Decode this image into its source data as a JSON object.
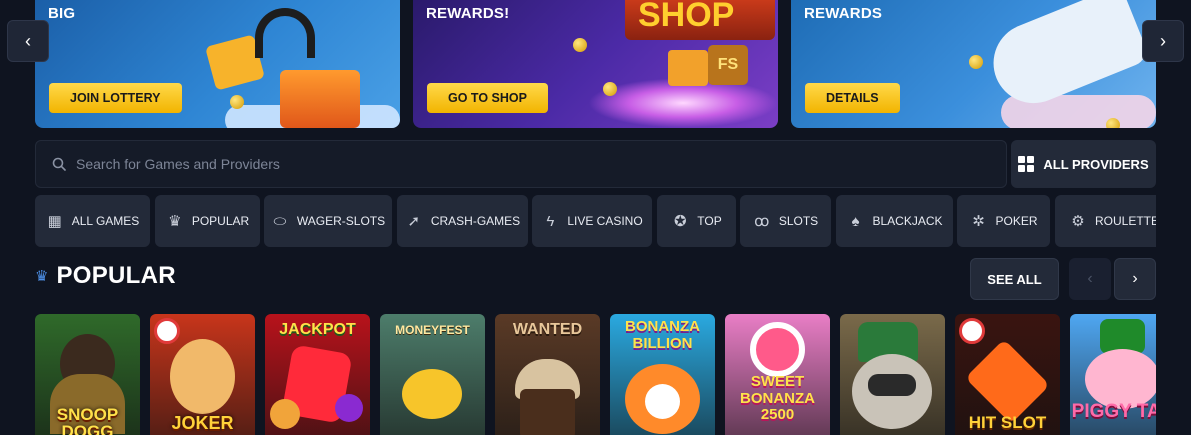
{
  "banners": [
    {
      "title": "BIG",
      "button": "JOIN LOTTERY"
    },
    {
      "title": "REWARDS!",
      "button": "GO TO SHOP",
      "art_text": "SHOP",
      "art_badge": "FS"
    },
    {
      "title": "REWARDS",
      "button": "DETAILS"
    }
  ],
  "carousel": {
    "prev_icon": "‹",
    "next_icon": "›"
  },
  "search": {
    "placeholder": "Search for Games and Providers"
  },
  "providers": {
    "label": "ALL PROVIDERS"
  },
  "categories": [
    {
      "label": "ALL GAMES",
      "icon": "grid-icon"
    },
    {
      "label": "POPULAR",
      "icon": "crown-icon"
    },
    {
      "label": "WAGER-SLOTS",
      "icon": "chip-icon"
    },
    {
      "label": "CRASH-GAMES",
      "icon": "rocket-icon"
    },
    {
      "label": "LIVE CASINO",
      "icon": "lightning-icon"
    },
    {
      "label": "TOP",
      "icon": "badge-icon"
    },
    {
      "label": "SLOTS",
      "icon": "cherries-icon"
    },
    {
      "label": "BLACKJACK",
      "icon": "cards-icon"
    },
    {
      "label": "POKER",
      "icon": "poker-chip-icon"
    },
    {
      "label": "ROULETTE",
      "icon": "roulette-icon"
    }
  ],
  "popular": {
    "title": "POPULAR",
    "see_all": "SEE ALL",
    "prev_icon": "‹",
    "next_icon": "›"
  },
  "games": [
    {
      "title": "SNOOP DOGG",
      "bg": "#2f6a2a"
    },
    {
      "title": "JOKER",
      "bg": "#c8351b"
    },
    {
      "title": "JACKPOT",
      "bg": "#b8121b"
    },
    {
      "title": "MONEYFEST",
      "bg": "#4d7d6b"
    },
    {
      "title": "WANTED",
      "bg": "#5a3a26"
    },
    {
      "title": "BONANZA BILLION",
      "bg": "#2aa9e0"
    },
    {
      "title": "SWEET BONANZA 2500",
      "bg": "#e97ec6"
    },
    {
      "title": "",
      "bg": "#7a6a4a"
    },
    {
      "title": "HIT SLOT",
      "bg": "#3a1410"
    },
    {
      "title": "PIGGY TAP",
      "bg": "#4fa7f2"
    }
  ],
  "colors": {
    "background": "#0f1420",
    "button_gold": "#f2b400",
    "tile": "#232a39",
    "accent_blue": "#4d8fe6"
  }
}
